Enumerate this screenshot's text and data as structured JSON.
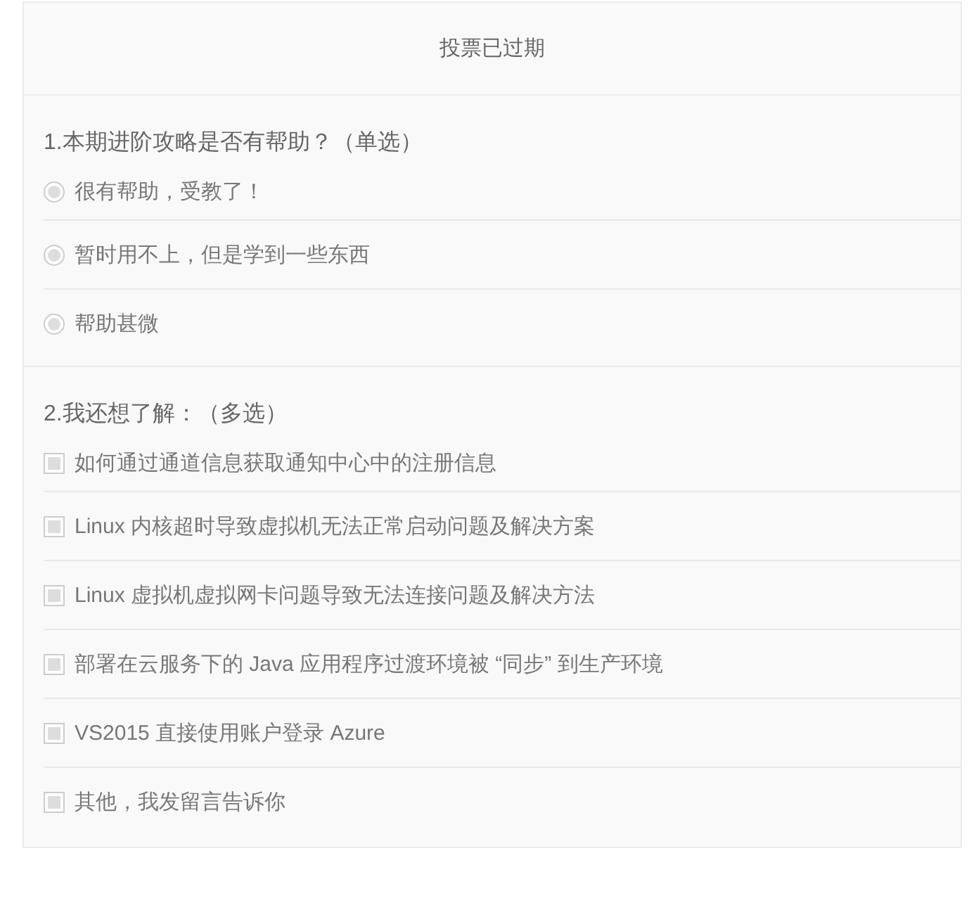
{
  "header": {
    "title": "投票已过期"
  },
  "questions": [
    {
      "title": "1.本期进阶攻略是否有帮助？（单选）",
      "kind": "single",
      "options": [
        {
          "label": "很有帮助，受教了！",
          "checked": false,
          "disabled": true
        },
        {
          "label": "暂时用不上，但是学到一些东西",
          "checked": false,
          "disabled": true
        },
        {
          "label": "帮助甚微",
          "checked": false,
          "disabled": true
        }
      ]
    },
    {
      "title": "2.我还想了解：（多选）",
      "kind": "multiple",
      "options": [
        {
          "label": "如何通过通道信息获取通知中心中的注册信息",
          "checked": false,
          "disabled": true
        },
        {
          "label": "Linux 内核超时导致虚拟机无法正常启动问题及解决方案",
          "checked": false,
          "disabled": true
        },
        {
          "label": "Linux 虚拟机虚拟网卡问题导致无法连接问题及解决方法",
          "checked": false,
          "disabled": true
        },
        {
          "label": "部署在云服务下的 Java 应用程序过渡环境被 “同步” 到生产环境",
          "checked": false,
          "disabled": true
        },
        {
          "label": "VS2015 直接使用账户登录 Azure",
          "checked": false,
          "disabled": true
        },
        {
          "label": "其他，我发留言告诉你",
          "checked": false,
          "disabled": true
        }
      ]
    }
  ]
}
